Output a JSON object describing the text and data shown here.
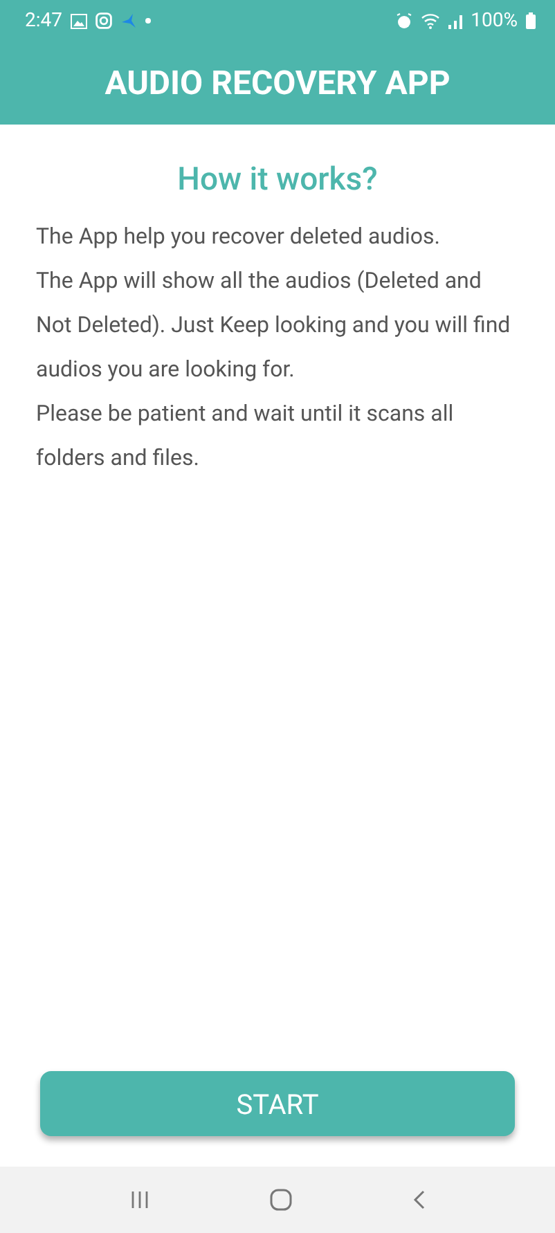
{
  "status_bar": {
    "time": "2:47",
    "battery": "100%"
  },
  "app_bar": {
    "title": "AUDIO RECOVERY APP"
  },
  "heading": "How it works?",
  "paragraphs": [
    "The App help you recover deleted audios.",
    "The App will show all the audios (Deleted and Not Deleted). Just Keep looking and you will find audios you are looking for.",
    "Please be patient and wait until it scans all folders and files."
  ],
  "start_button": {
    "label": "START"
  }
}
